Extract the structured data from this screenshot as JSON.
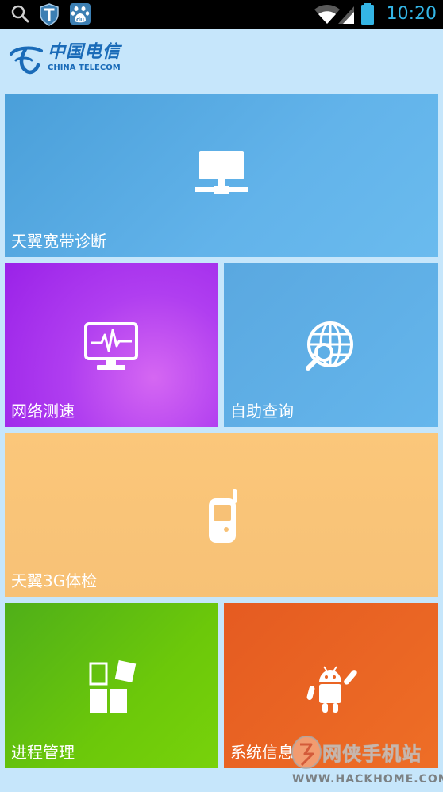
{
  "status_bar": {
    "time": "10:20",
    "icons": [
      "search-icon",
      "shield-icon",
      "baidu-paw-icon",
      "wifi-icon",
      "signal-icon",
      "battery-icon"
    ],
    "time_color": "#34b5e5"
  },
  "header": {
    "logo_cn": "中国电信",
    "logo_en": "CHINA TELECOM",
    "brand_color": "#1a6bb8"
  },
  "tiles": [
    {
      "label": "天翼宽带诊断",
      "icon": "network-terminal-icon",
      "color": "#5aabe3"
    },
    {
      "label": "网络测速",
      "icon": "monitor-pulse-icon",
      "color": "#b03ef0"
    },
    {
      "label": "自助查询",
      "icon": "globe-search-icon",
      "color": "#5fafe6"
    },
    {
      "label": "天翼3G体检",
      "icon": "mobile-phone-icon",
      "color": "#f9c478"
    },
    {
      "label": "进程管理",
      "icon": "app-blocks-icon",
      "color": "#62bd12"
    },
    {
      "label": "系统信息",
      "icon": "android-robot-icon",
      "color": "#ea6524"
    }
  ],
  "watermark": {
    "text": "网侠手机站",
    "url": "WWW.HACKHOME.COM"
  }
}
